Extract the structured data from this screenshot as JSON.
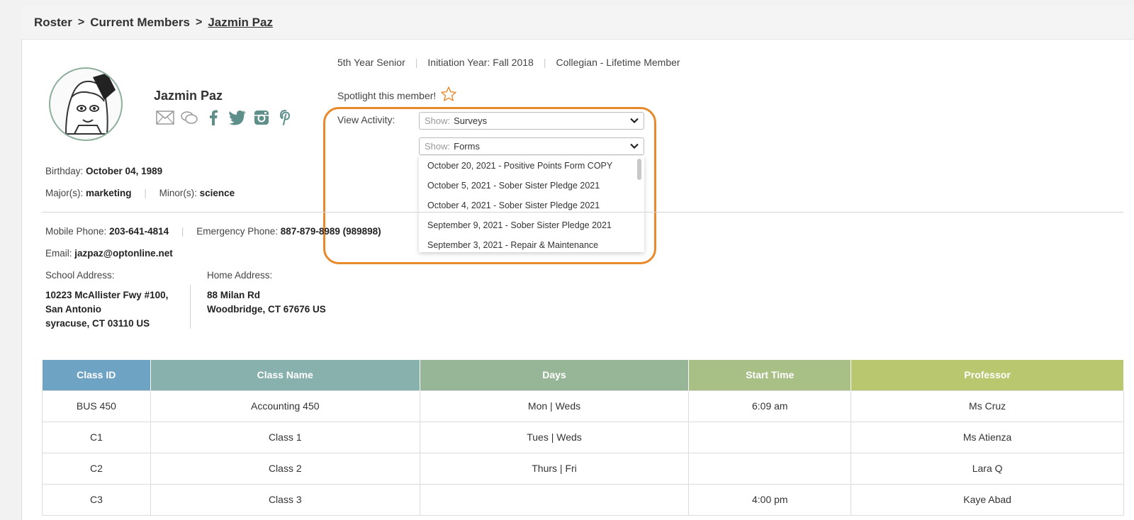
{
  "breadcrumb": {
    "root": "Roster",
    "middle": "Current Members",
    "current": "Jazmin Paz",
    "separator": ">"
  },
  "member": {
    "name": "Jazmin Paz"
  },
  "meta": {
    "year": "5th Year Senior",
    "initiation": "Initiation Year: Fall 2018",
    "status": "Collegian - Lifetime Member"
  },
  "spotlight": {
    "label": "Spotlight this member!"
  },
  "activity": {
    "label": "View Activity:",
    "surveys_select": {
      "prefix": "Show:",
      "value": "Surveys"
    },
    "forms_select": {
      "prefix": "Show:",
      "value": "Forms"
    },
    "options": [
      "October 20, 2021 - Positive Points Form COPY",
      "October 5, 2021 - Sober Sister Pledge 2021",
      "October 4, 2021 - Sober Sister Pledge 2021",
      "September 9, 2021 - Sober Sister Pledge 2021",
      "September 3, 2021 - Repair & Maintenance"
    ]
  },
  "details": {
    "birthday_label": "Birthday:",
    "birthday": "October 04, 1989",
    "major_label": "Major(s):",
    "major": "marketing",
    "minor_label": "Minor(s):",
    "minor": "science",
    "mobile_label": "Mobile Phone:",
    "mobile": "203-641-4814",
    "emergency_label": "Emergency Phone:",
    "emergency": "887-879-8989 (989898)",
    "email_label": "Email:",
    "email": "jazpaz@optonline.net",
    "school_label": "School Address:",
    "school_line1": "10223 McAllister Fwy #100,",
    "school_line2": "San Antonio",
    "school_line3": "syracuse, CT 03110 US",
    "home_label": "Home Address:",
    "home_line1": "88 Milan Rd",
    "home_line2": "Woodbridge, CT 67676 US"
  },
  "table": {
    "headers": [
      "Class ID",
      "Class Name",
      "Days",
      "Start Time",
      "Professor"
    ],
    "header_colors": [
      "#6fa3c4",
      "#88b0ad",
      "#97b697",
      "#a8bf86",
      "#b9c76e"
    ],
    "rows": [
      [
        "BUS 450",
        "Accounting 450",
        "Mon | Weds",
        "6:09 am",
        "Ms Cruz"
      ],
      [
        "C1",
        "Class 1",
        "Tues | Weds",
        "",
        "Ms Atienza"
      ],
      [
        "C2",
        "Class 2",
        "Thurs | Fri",
        "",
        "Lara Q"
      ],
      [
        "C3",
        "Class 3",
        "",
        "4:00 pm",
        "Kaye Abad"
      ]
    ]
  },
  "colors": {
    "highlight": "#e8892b",
    "social_icon": "#5f8f8a",
    "star": "#e8892b"
  },
  "icons": [
    "mail-icon",
    "chat-icon",
    "facebook-icon",
    "twitter-icon",
    "instagram-icon",
    "pinterest-icon",
    "star-icon",
    "chevron-down-icon"
  ]
}
